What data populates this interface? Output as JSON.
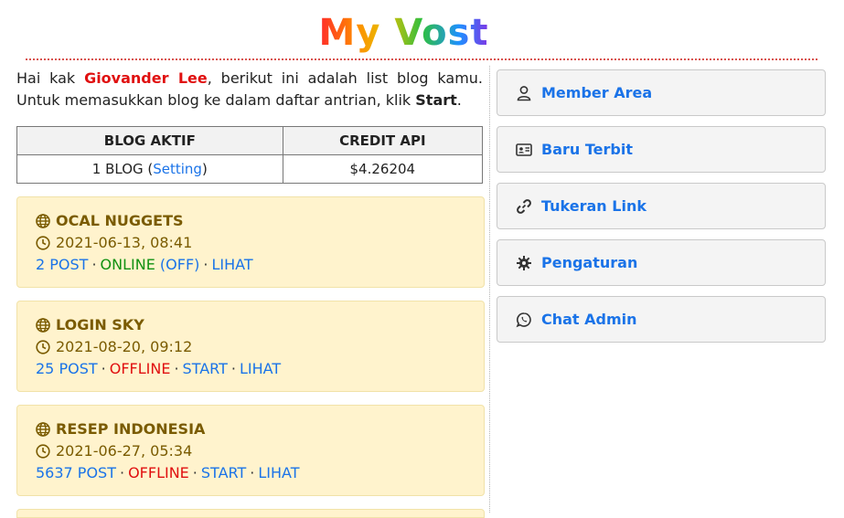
{
  "header": {
    "title": "My Vost",
    "trademark": "™"
  },
  "intro": {
    "greeting": "Hai kak ",
    "user_name": "Giovander Lee",
    "text_middle": ", berikut ini adalah list blog kamu. Untuk memasukkan blog ke dalam daftar antrian, klik ",
    "start_word": "Start",
    "text_end": "."
  },
  "summary": {
    "headers": [
      "BLOG AKTIF",
      "CREDIT API"
    ],
    "blog_active_prefix": "1 BLOG (",
    "blog_active_link": "Setting",
    "blog_active_suffix": ")",
    "credit": "$4.26204"
  },
  "blogs": [
    {
      "name": "OCAL NUGGETS",
      "date": "2021-06-13, 08:41",
      "posts": "2 POST",
      "status": "ONLINE",
      "status_color": "#119111",
      "toggle": "OFF",
      "view": "LIHAT"
    },
    {
      "name": "LOGIN SKY",
      "date": "2021-08-20, 09:12",
      "posts": "25 POST",
      "status": "OFFLINE",
      "status_color": "#e01010",
      "action": "START",
      "view": "LIHAT"
    },
    {
      "name": "RESEP INDONESIA",
      "date": "2021-06-27, 05:34",
      "posts": "5637 POST",
      "status": "OFFLINE",
      "status_color": "#e01010",
      "action": "START",
      "view": "LIHAT"
    }
  ],
  "menu": [
    {
      "label": "Member Area",
      "icon": "user-icon"
    },
    {
      "label": "Baru Terbit",
      "icon": "id-card-icon"
    },
    {
      "label": "Tukeran Link",
      "icon": "link-icon"
    },
    {
      "label": "Pengaturan",
      "icon": "gear-icon"
    },
    {
      "label": "Chat Admin",
      "icon": "whatsapp-icon"
    }
  ],
  "colors": {
    "link": "#1a73e8",
    "card_bg": "#fff3cd",
    "card_text": "#7a5b00",
    "online": "#119111",
    "offline": "#e01010"
  }
}
